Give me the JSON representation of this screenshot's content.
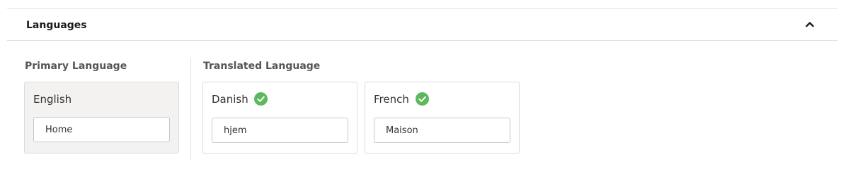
{
  "panel": {
    "title": "Languages",
    "toggle_icon": "chevron-up-icon"
  },
  "primary": {
    "section_label": "Primary Language",
    "language": "English",
    "value": "Home"
  },
  "translated": {
    "section_label": "Translated Language",
    "items": [
      {
        "language": "Danish",
        "status_icon": "check-circle-icon",
        "value": "hjem"
      },
      {
        "language": "French",
        "status_icon": "check-circle-icon",
        "value": "Maison"
      }
    ]
  },
  "colors": {
    "status_ok": "#5cb85c",
    "primary_card_bg": "#f3f2f1"
  }
}
